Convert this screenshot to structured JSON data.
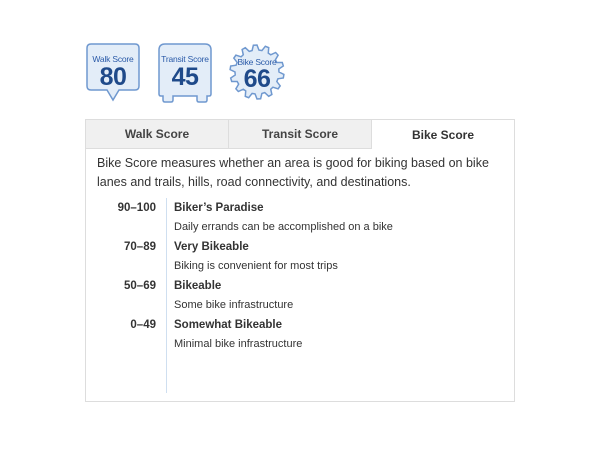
{
  "badges": [
    {
      "label": "Walk Score",
      "value": "80"
    },
    {
      "label": "Transit Score",
      "value": "45"
    },
    {
      "label": "Bike Score",
      "value": "66"
    }
  ],
  "tabs": [
    {
      "label": "Walk Score",
      "active": false
    },
    {
      "label": "Transit Score",
      "active": false
    },
    {
      "label": "Bike Score",
      "active": true
    }
  ],
  "description": "Bike Score measures whether an area is good for biking based on bike lanes and trails, hills, road connectivity, and destinations.",
  "levels": [
    {
      "range": "90–100",
      "title": "Biker’s Paradise",
      "desc": "Daily errands can be accomplished on a bike"
    },
    {
      "range": "70–89",
      "title": "Very Bikeable",
      "desc": "Biking is convenient for most trips"
    },
    {
      "range": "50–69",
      "title": "Bikeable",
      "desc": "Some bike infrastructure"
    },
    {
      "range": "0–49",
      "title": "Somewhat Bikeable",
      "desc": "Minimal bike infrastructure"
    }
  ],
  "colors": {
    "badge_fill": "#e3edf8",
    "badge_border": "#6f98cf",
    "badge_text": "#1f4a8a",
    "tab_bar": "#f0f0f0",
    "divider": "#cfdff0"
  },
  "icons": {
    "walk": "map-pin-badge-icon",
    "transit": "bus-badge-icon",
    "bike": "gear-badge-icon"
  }
}
